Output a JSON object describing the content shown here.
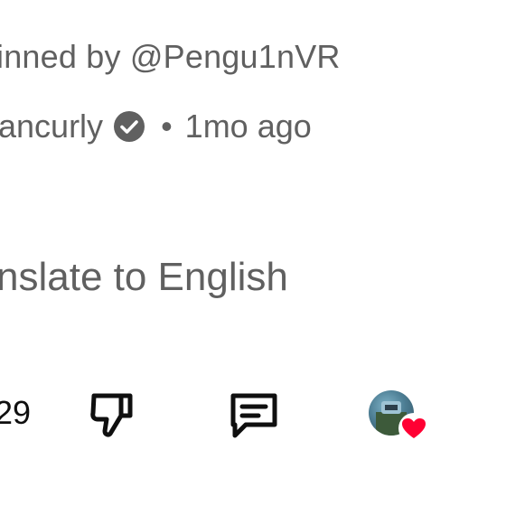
{
  "comment": {
    "pinned_text": "inned by @Pengu1nVR",
    "author": "ancurly",
    "separator": "•",
    "time_ago": "1mo ago",
    "translate_label": "nslate to English",
    "like_count": "29"
  },
  "icons": {
    "verified": "verified-check-icon",
    "dislike": "thumbs-down-icon",
    "reply": "comment-icon",
    "creator_heart": "heart-icon"
  },
  "colors": {
    "meta_text": "#606060",
    "primary_text": "#0f0f0f",
    "heart": "#ff0033",
    "verified_badge": "#606060"
  }
}
